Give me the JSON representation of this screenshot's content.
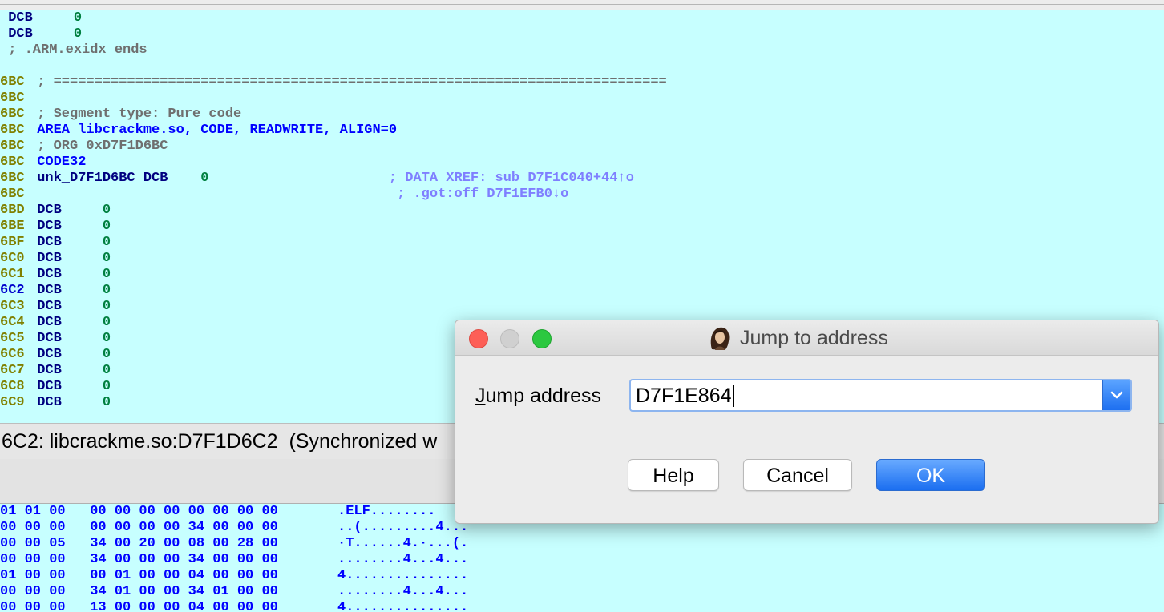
{
  "disassembly": {
    "lines": [
      {
        "addr": "",
        "parts": [
          {
            "t": " DCB     ",
            "c": "navy"
          },
          {
            "t": "0",
            "c": "green"
          }
        ]
      },
      {
        "addr": "",
        "parts": [
          {
            "t": " DCB     ",
            "c": "navy"
          },
          {
            "t": "0",
            "c": "green"
          }
        ]
      },
      {
        "addr": "",
        "parts": [
          {
            "t": " ; .ARM.exidx ends",
            "c": "gray"
          }
        ]
      },
      {
        "addr": "",
        "parts": []
      },
      {
        "addr": "6BC",
        "parts": [
          {
            "t": " ; ===========================================================================",
            "c": "gray"
          }
        ]
      },
      {
        "addr": "6BC",
        "parts": []
      },
      {
        "addr": "6BC",
        "parts": [
          {
            "t": " ; Segment type: Pure code",
            "c": "gray"
          }
        ]
      },
      {
        "addr": "6BC",
        "parts": [
          {
            "t": " AREA libcrackme.so, CODE, READWRITE, ALIGN=0",
            "c": "blue"
          }
        ]
      },
      {
        "addr": "6BC",
        "parts": [
          {
            "t": " ; ORG 0xD7F1D6BC",
            "c": "gray"
          }
        ]
      },
      {
        "addr": "6BC",
        "parts": [
          {
            "t": " CODE32",
            "c": "blue"
          }
        ]
      },
      {
        "addr": "6BC",
        "parts": [
          {
            "t": " unk_D7F1D6BC DCB    ",
            "c": "navy"
          },
          {
            "t": "0",
            "c": "green"
          },
          {
            "t": "                      ; DATA XREF: sub D7F1C040+44↑o",
            "c": "xref"
          }
        ]
      },
      {
        "addr": "6BC",
        "parts": [
          {
            "t": "                                             ; .got:off D7F1EFB0↓o",
            "c": "xref"
          }
        ]
      },
      {
        "addr": "6BD",
        "parts": [
          {
            "t": " DCB     ",
            "c": "navy"
          },
          {
            "t": "0",
            "c": "green"
          }
        ]
      },
      {
        "addr": "6BE",
        "parts": [
          {
            "t": " DCB     ",
            "c": "navy"
          },
          {
            "t": "0",
            "c": "green"
          }
        ]
      },
      {
        "addr": "6BF",
        "parts": [
          {
            "t": " DCB     ",
            "c": "navy"
          },
          {
            "t": "0",
            "c": "green"
          }
        ]
      },
      {
        "addr": "6C0",
        "parts": [
          {
            "t": " DCB     ",
            "c": "navy"
          },
          {
            "t": "0",
            "c": "green"
          }
        ]
      },
      {
        "addr": "6C1",
        "parts": [
          {
            "t": " DCB     ",
            "c": "navy"
          },
          {
            "t": "0",
            "c": "green"
          }
        ]
      },
      {
        "addr": "6C2",
        "current": true,
        "parts": [
          {
            "t": " DCB     ",
            "c": "navy"
          },
          {
            "t": "0",
            "c": "green"
          }
        ]
      },
      {
        "addr": "6C3",
        "parts": [
          {
            "t": " DCB     ",
            "c": "navy"
          },
          {
            "t": "0",
            "c": "green"
          }
        ]
      },
      {
        "addr": "6C4",
        "parts": [
          {
            "t": " DCB     ",
            "c": "navy"
          },
          {
            "t": "0",
            "c": "green"
          }
        ]
      },
      {
        "addr": "6C5",
        "parts": [
          {
            "t": " DCB     ",
            "c": "navy"
          },
          {
            "t": "0",
            "c": "green"
          }
        ]
      },
      {
        "addr": "6C6",
        "parts": [
          {
            "t": " DCB     ",
            "c": "navy"
          },
          {
            "t": "0",
            "c": "green"
          }
        ]
      },
      {
        "addr": "6C7",
        "parts": [
          {
            "t": " DCB     ",
            "c": "navy"
          },
          {
            "t": "0",
            "c": "green"
          }
        ]
      },
      {
        "addr": "6C8",
        "parts": [
          {
            "t": " DCB     ",
            "c": "navy"
          },
          {
            "t": "0",
            "c": "green"
          }
        ]
      },
      {
        "addr": "6C9",
        "parts": [
          {
            "t": " DCB     ",
            "c": "navy"
          },
          {
            "t": "0",
            "c": "green"
          }
        ]
      }
    ]
  },
  "status_bar": {
    "text": "6C2: libcrackme.so:D7F1D6C2  (Synchronized w"
  },
  "hex_view": {
    "rows": [
      {
        "bytes": "01 01 00   00 00 00 00 00 00 00 00",
        "ascii": ".ELF........"
      },
      {
        "bytes": "00 00 00   00 00 00 00 34 00 00 00",
        "ascii": "..(.........4..."
      },
      {
        "bytes": "00 00 05   34 00 20 00 08 00 28 00",
        "ascii": "·T......4.·...(."
      },
      {
        "bytes": "00 00 00   34 00 00 00 34 00 00 00",
        "ascii": "........4...4..."
      },
      {
        "bytes": "01 00 00   00 01 00 00 04 00 00 00",
        "ascii": "4..............."
      },
      {
        "bytes": "00 00 00   34 01 00 00 34 01 00 00",
        "ascii": "........4...4..."
      },
      {
        "bytes": "00 00 00   13 00 00 00 04 00 00 00",
        "ascii": "4..............."
      }
    ]
  },
  "dialog": {
    "title": "Jump to address",
    "field_label_mnemonic": "J",
    "field_label_rest": "ump address",
    "jump_address_value": "D7F1E864",
    "buttons": {
      "help": "Help",
      "cancel": "Cancel",
      "ok": "OK"
    }
  },
  "colors": {
    "background": "#c7ffff",
    "address": "#808000",
    "keyword": "#000080",
    "value": "#008040",
    "comment": "#6f6f6f",
    "xref": "#7f7fff",
    "accent": "#1b6ef0"
  }
}
